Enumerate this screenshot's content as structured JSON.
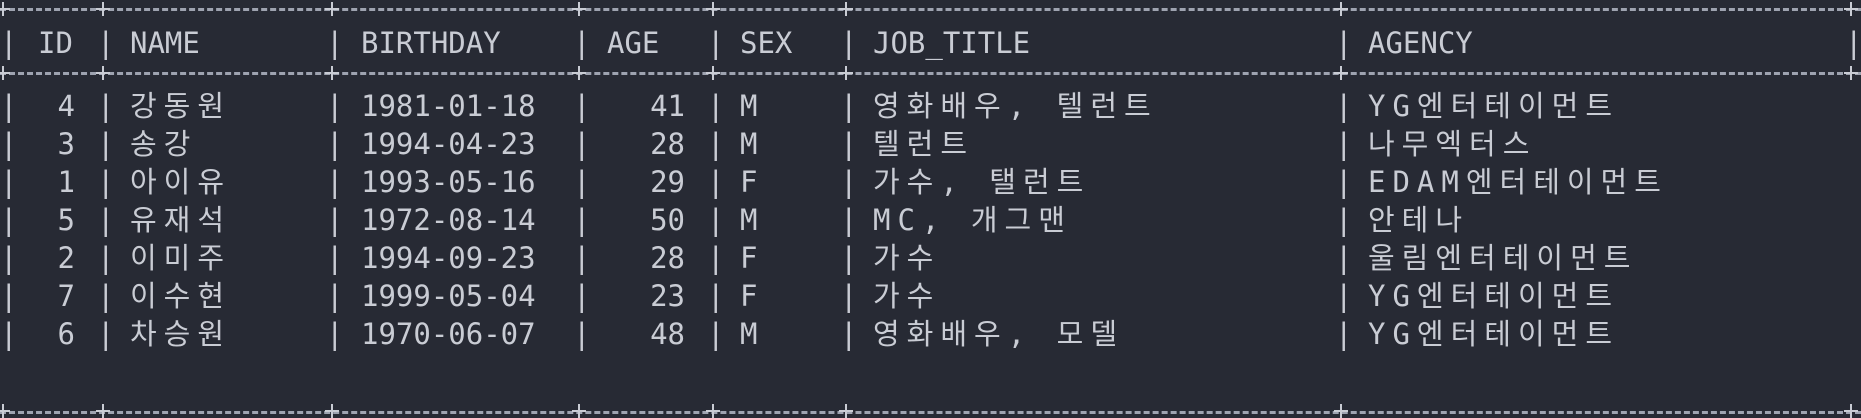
{
  "table": {
    "columns": [
      "ID",
      "NAME",
      "BIRTHDAY",
      "AGE",
      "SEX",
      "JOB_TITLE",
      "AGENCY"
    ],
    "rows": [
      {
        "id": "4",
        "name": "강동원",
        "birthday": "1981-01-18",
        "age": "41",
        "sex": "M",
        "job_title": "영화배우, 텔런트",
        "agency": "YG엔터테이먼트"
      },
      {
        "id": "3",
        "name": "송강",
        "birthday": "1994-04-23",
        "age": "28",
        "sex": "M",
        "job_title": "텔런트",
        "agency": "나무엑터스"
      },
      {
        "id": "1",
        "name": "아이유",
        "birthday": "1993-05-16",
        "age": "29",
        "sex": "F",
        "job_title": "가수, 탤런트",
        "agency": "EDAM엔터테이먼트"
      },
      {
        "id": "5",
        "name": "유재석",
        "birthday": "1972-08-14",
        "age": "50",
        "sex": "M",
        "job_title": "MC, 개그맨",
        "agency": "안테나"
      },
      {
        "id": "2",
        "name": "이미주",
        "birthday": "1994-09-23",
        "age": "28",
        "sex": "F",
        "job_title": "가수",
        "agency": "울림엔터테이먼트"
      },
      {
        "id": "7",
        "name": "이수현",
        "birthday": "1999-05-04",
        "age": "23",
        "sex": "F",
        "job_title": "가수",
        "agency": "YG엔터테이먼트"
      },
      {
        "id": "6",
        "name": "차승원",
        "birthday": "1970-06-07",
        "age": "48",
        "sex": "M",
        "job_title": "영화배우, 모델",
        "agency": "YG엔터테이먼트"
      }
    ]
  },
  "colors": {
    "background": "#272a34",
    "text": "#c9ccd4",
    "border": "#9ea3b0"
  }
}
